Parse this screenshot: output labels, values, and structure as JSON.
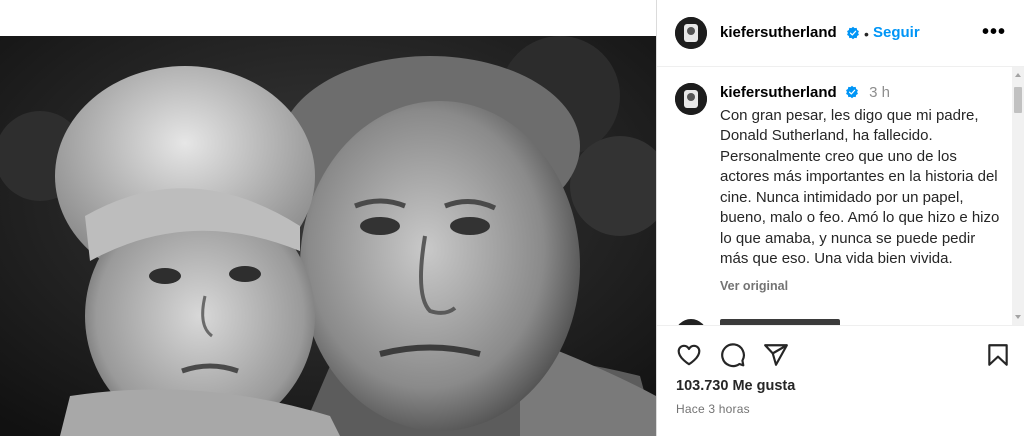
{
  "post": {
    "image_alt": "Foto en blanco y negro de un hombre y un niño",
    "author": {
      "username": "kiefersutherland",
      "verified": true
    },
    "follow_label": "Seguir",
    "separator": "•",
    "more_label": "•••",
    "caption": {
      "username": "kiefersutherland",
      "time": "3 h",
      "text": "Con gran pesar, les digo que mi padre, Donald Sutherland, ha fallecido. Personalmente creo que uno de los actores más importantes en la historia del cine. Nunca intimidado por un papel, bueno, malo o feo. Amó lo que hizo e hizo lo que amaba, y nunca se puede pedir más que eso. Una vida bien vivida.",
      "see_original": "Ver original"
    },
    "likes_text": "103.730 Me gusta",
    "posted_ago": "Hace 3 horas"
  },
  "icons": {
    "like": "heart-icon",
    "comment": "comment-icon",
    "share": "share-icon",
    "save": "bookmark-icon",
    "verified": "verified-badge-icon",
    "more": "more-options-icon"
  },
  "colors": {
    "link_blue": "#0095f6",
    "verified_blue": "#0095f6",
    "text": "#262626",
    "muted": "#737373",
    "border": "#dbdbdb"
  }
}
